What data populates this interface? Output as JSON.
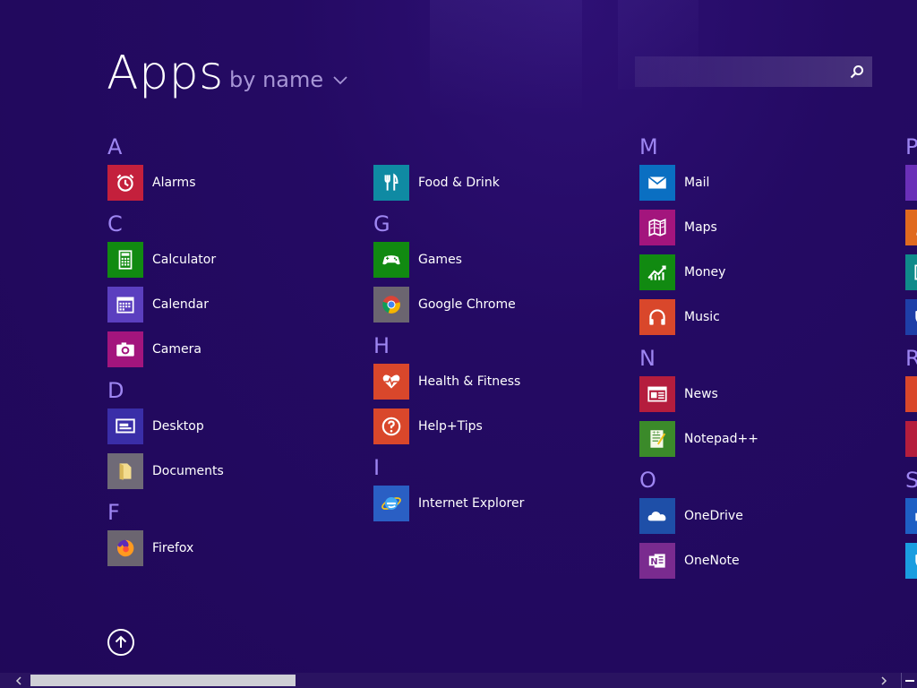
{
  "header": {
    "title": "Apps",
    "sort_label": "by name"
  },
  "search": {
    "value": "",
    "placeholder": ""
  },
  "columns": [
    {
      "groups": [
        {
          "letter": "A",
          "apps": [
            {
              "label": "Alarms",
              "color": "#c4203c",
              "icon": "alarm-clock-icon"
            }
          ]
        },
        {
          "letter": "C",
          "apps": [
            {
              "label": "Calculator",
              "color": "#118a11",
              "icon": "calculator-icon"
            },
            {
              "label": "Calendar",
              "color": "#5b3fbf",
              "icon": "calendar-icon"
            },
            {
              "label": "Camera",
              "color": "#a3157d",
              "icon": "camera-icon"
            }
          ]
        },
        {
          "letter": "D",
          "apps": [
            {
              "label": "Desktop",
              "color": "#3a2ea8",
              "icon": "desktop-icon"
            },
            {
              "label": "Documents",
              "color": "#6f6a77",
              "icon": "folder-icon"
            }
          ]
        },
        {
          "letter": "F",
          "apps": [
            {
              "label": "Firefox",
              "color": "#6b6570",
              "icon": "firefox-icon"
            }
          ]
        }
      ]
    },
    {
      "groups": [
        {
          "letter": "",
          "apps": [
            {
              "label": "Food & Drink",
              "color": "#0f8aa3",
              "icon": "fork-knife-icon"
            }
          ]
        },
        {
          "letter": "G",
          "apps": [
            {
              "label": "Games",
              "color": "#118a11",
              "icon": "gamepad-icon"
            },
            {
              "label": "Google Chrome",
              "color": "#6b6570",
              "icon": "chrome-icon"
            }
          ]
        },
        {
          "letter": "H",
          "apps": [
            {
              "label": "Health & Fitness",
              "color": "#d9472b",
              "icon": "heart-pulse-icon"
            },
            {
              "label": "Help+Tips",
              "color": "#d9472b",
              "icon": "question-icon"
            }
          ]
        },
        {
          "letter": "I",
          "apps": [
            {
              "label": "Internet Explorer",
              "color": "#2a5fc4",
              "icon": "internet-explorer-icon"
            }
          ]
        }
      ]
    },
    {
      "groups": [
        {
          "letter": "M",
          "apps": [
            {
              "label": "Mail",
              "color": "#0a6fc2",
              "icon": "mail-icon"
            },
            {
              "label": "Maps",
              "color": "#a3157d",
              "icon": "map-icon"
            },
            {
              "label": "Money",
              "color": "#118a11",
              "icon": "chart-icon"
            },
            {
              "label": "Music",
              "color": "#d9472b",
              "icon": "headphones-icon"
            }
          ]
        },
        {
          "letter": "N",
          "apps": [
            {
              "label": "News",
              "color": "#b51d3d",
              "icon": "news-icon"
            },
            {
              "label": "Notepad++",
              "color": "#3b8a2a",
              "icon": "notepad-icon"
            }
          ]
        },
        {
          "letter": "O",
          "apps": [
            {
              "label": "OneDrive",
              "color": "#1e4fa8",
              "icon": "cloud-icon"
            },
            {
              "label": "OneNote",
              "color": "#7a2b8f",
              "icon": "onenote-icon"
            }
          ]
        }
      ]
    },
    {
      "groups": [
        {
          "letter": "P",
          "apps": [
            {
              "label": "",
              "color": "#6a2fb8",
              "icon": "gear-icon"
            },
            {
              "label": "",
              "color": "#e06a1f",
              "icon": "people-icon"
            },
            {
              "label": "",
              "color": "#0f8a8a",
              "icon": "photos-icon"
            },
            {
              "label": "",
              "color": "#1e3fa8",
              "icon": "shield-icon"
            }
          ]
        },
        {
          "letter": "R",
          "apps": [
            {
              "label": "",
              "color": "#d9472b",
              "icon": "reader-icon"
            },
            {
              "label": "",
              "color": "#b51d3d",
              "icon": "reading-list-icon"
            }
          ]
        },
        {
          "letter": "S",
          "apps": [
            {
              "label": "",
              "color": "#1e5fc4",
              "icon": "scan-icon"
            },
            {
              "label": "",
              "color": "#1a9de0",
              "icon": "shield-icon"
            }
          ]
        }
      ]
    }
  ]
}
